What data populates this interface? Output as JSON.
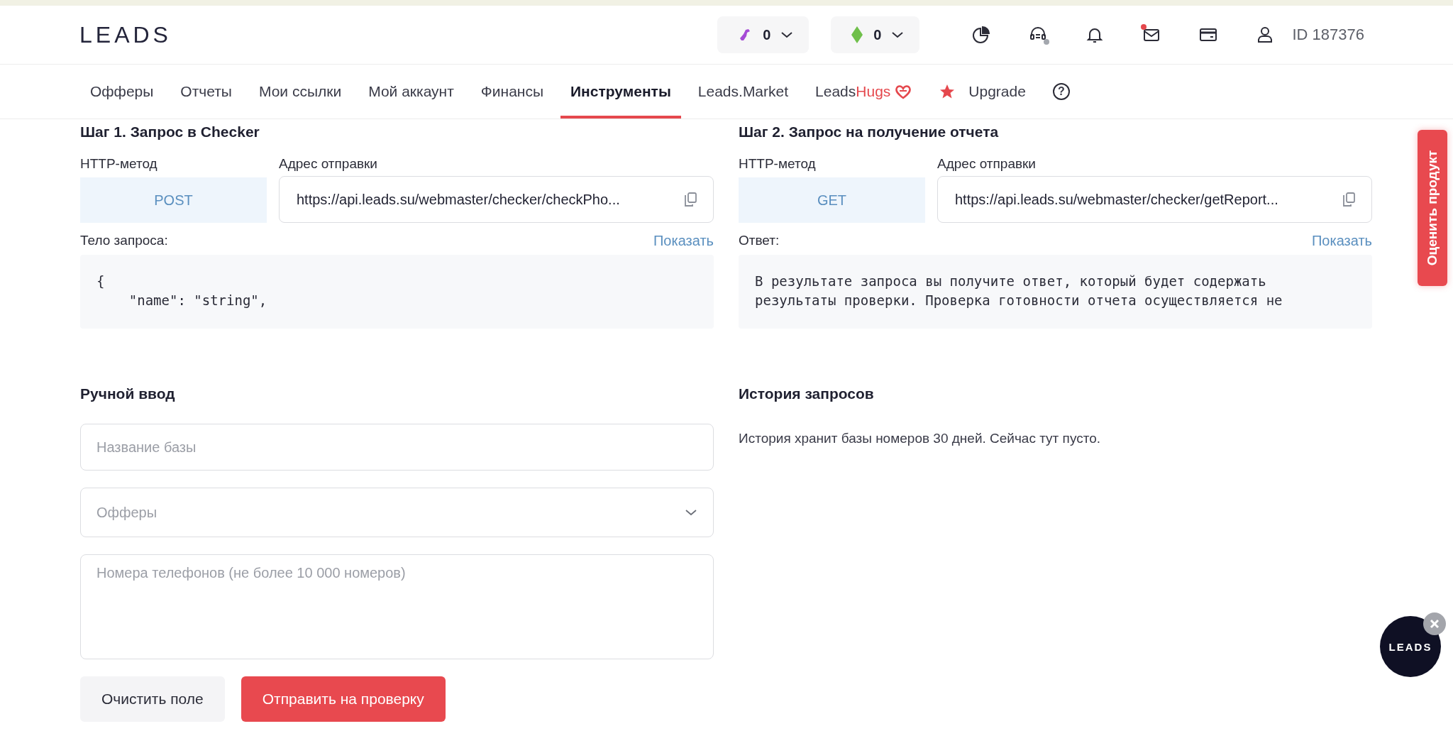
{
  "logo": "LEADS",
  "balances": [
    {
      "kind": "dino",
      "value": "0"
    },
    {
      "kind": "gem",
      "value": "0"
    }
  ],
  "header_icons": [
    {
      "kind": "chart"
    },
    {
      "kind": "support",
      "color": "#a3a7ae"
    },
    {
      "kind": "bell"
    },
    {
      "kind": "mail",
      "color": "#e5484d"
    },
    {
      "kind": "card"
    },
    {
      "kind": "user"
    }
  ],
  "user_id": "ID 187376",
  "nav": [
    {
      "kind": "plain",
      "label": "Офферы",
      "selected": false
    },
    {
      "kind": "plain",
      "label": "Отчеты",
      "selected": false
    },
    {
      "kind": "plain",
      "label": "Мои ссылки",
      "selected": false
    },
    {
      "kind": "plain",
      "label": "Мой аккаунт",
      "selected": false
    },
    {
      "kind": "plain",
      "label": "Финансы",
      "selected": false
    },
    {
      "kind": "plain",
      "label": "Инструменты",
      "selected": true
    },
    {
      "kind": "plain",
      "label": "Leads.Market",
      "selected": false
    },
    {
      "kind": "hugs",
      "label": "Leads",
      "accent": "Hugs",
      "selected": false
    },
    {
      "kind": "upgrade",
      "label": "Upgrade",
      "selected": false
    },
    {
      "kind": "help",
      "label": "?",
      "selected": false
    }
  ],
  "steps": [
    {
      "title": "Шаг 1. Запрос в Checker",
      "method_label": "HTTP-метод",
      "method": "POST",
      "address_label": "Адрес отправки",
      "address": "https://api.leads.su/webmaster/checker/checkPho...",
      "body_label": "Тело запроса:",
      "toggle": "Показать",
      "body_lines": [
        "{",
        "    \"name\": \"string\","
      ]
    },
    {
      "title": "Шаг 2. Запрос на получение отчета",
      "method_label": "HTTP-метод",
      "method": "GET",
      "address_label": "Адрес отправки",
      "address": "https://api.leads.su/webmaster/checker/getReport...",
      "body_label": "Ответ:",
      "toggle": "Показать",
      "body_lines": [
        "В результате запроса вы получите ответ, который будет содержать",
        "результаты проверки. Проверка готовности отчета осуществляется не"
      ]
    }
  ],
  "manual": {
    "title": "Ручной ввод",
    "fields": [
      {
        "kind": "input",
        "placeholder": "Название базы"
      },
      {
        "kind": "select",
        "placeholder": "Офферы"
      },
      {
        "kind": "textarea",
        "placeholder": "Номера телефонов (не более 10 000 номеров)"
      }
    ],
    "buttons": [
      {
        "kind": "secondary",
        "label": "Очистить поле"
      },
      {
        "kind": "primary",
        "label": "Отправить на проверку"
      }
    ]
  },
  "history": {
    "title": "История запросов",
    "text": "История хранит базы номеров 30 дней. Сейчас тут пусто."
  },
  "feedback_tab": "Оценить продукт",
  "chat": {
    "label": "LEADS"
  }
}
